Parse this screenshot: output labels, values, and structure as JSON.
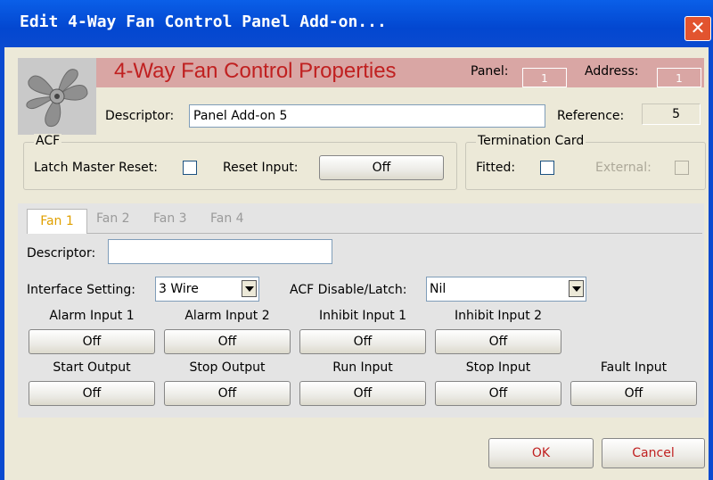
{
  "window": {
    "title": "Edit 4-Way Fan Control Panel Add-on...",
    "close_glyph": "✕"
  },
  "header": {
    "title": "4-Way Fan Control Properties",
    "panel_label": "Panel:",
    "panel_value": "1",
    "address_label": "Address:",
    "address_value": "1",
    "descriptor_label": "Descriptor:",
    "descriptor_value": "Panel Add-on 5",
    "reference_label": "Reference:",
    "reference_value": "5"
  },
  "acf": {
    "title": "ACF",
    "latch_label": "Latch Master Reset:",
    "reset_input_label": "Reset Input:",
    "reset_input_value": "Off"
  },
  "termination": {
    "title": "Termination Card",
    "fitted_label": "Fitted:",
    "external_label": "External:"
  },
  "tabs": [
    "Fan 1",
    "Fan 2",
    "Fan 3",
    "Fan 4"
  ],
  "fan": {
    "descriptor_label": "Descriptor:",
    "descriptor_value": "",
    "interface_label": "Interface Setting:",
    "interface_value": "3 Wire",
    "acf_label": "ACF Disable/Latch:",
    "acf_value": "Nil",
    "row1": [
      {
        "label": "Alarm Input 1",
        "value": "Off"
      },
      {
        "label": "Alarm Input 2",
        "value": "Off"
      },
      {
        "label": "Inhibit Input 1",
        "value": "Off"
      },
      {
        "label": "Inhibit Input 2",
        "value": "Off"
      }
    ],
    "row2": [
      {
        "label": "Start Output",
        "value": "Off"
      },
      {
        "label": "Stop Output",
        "value": "Off"
      },
      {
        "label": "Run Input",
        "value": "Off"
      },
      {
        "label": "Stop Input",
        "value": "Off"
      },
      {
        "label": "Fault Input",
        "value": "Off"
      }
    ]
  },
  "buttons": {
    "ok": "OK",
    "cancel": "Cancel"
  },
  "colors": {
    "titlebar": "#0347d0",
    "header_strip": "#d9a6a4",
    "title_red": "#c02020",
    "active_tab": "#e0a000"
  },
  "icons": {
    "fan": "fan-icon",
    "close": "close-icon",
    "dropdown": "chevron-down-icon"
  }
}
